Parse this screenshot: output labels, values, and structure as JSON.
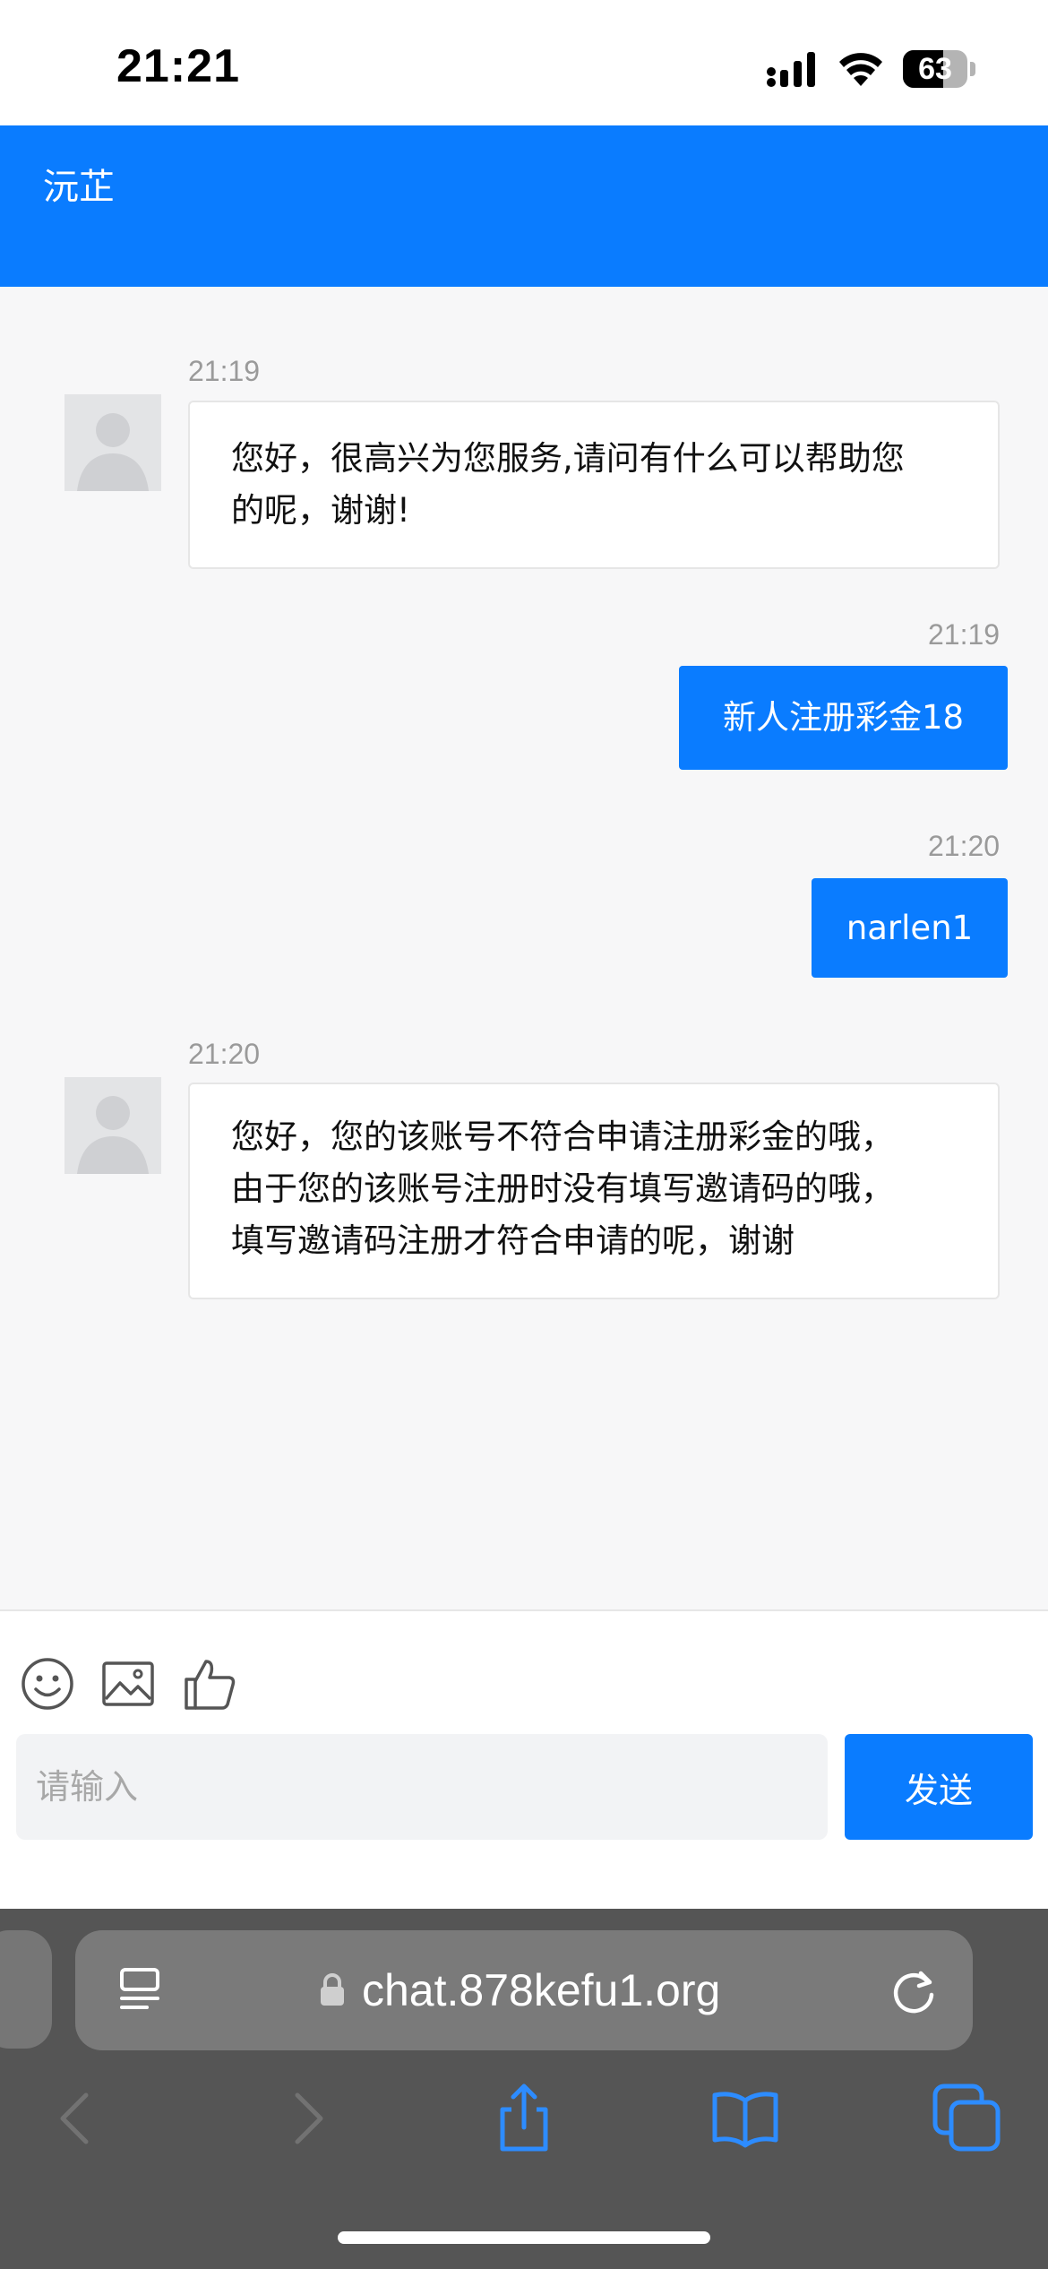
{
  "status_bar": {
    "time": "21:21",
    "battery_level": "63",
    "battery_fraction": 0.63
  },
  "header": {
    "title": "沅芷"
  },
  "messages": [
    {
      "direction": "in",
      "time": "21:19",
      "text_lines": [
        "您好，很高兴为您服务,请问有什么可以帮助您",
        "的呢，谢谢!"
      ]
    },
    {
      "direction": "out",
      "time": "21:19",
      "text": "新人注册彩金18"
    },
    {
      "direction": "out",
      "time": "21:20",
      "text": "narlen1"
    },
    {
      "direction": "in",
      "time": "21:20",
      "text_lines": [
        "您好，您的该账号不符合申请注册彩金的哦，",
        "由于您的该账号注册时没有填写邀请码的哦，",
        "填写邀请码注册才符合申请的呢，谢谢"
      ]
    }
  ],
  "toolbar": {
    "icons": [
      "emoji-icon",
      "image-icon",
      "thumbs-up-icon"
    ]
  },
  "input": {
    "placeholder": "请输入",
    "value": "",
    "send_label": "发送"
  },
  "browser": {
    "url": "chat.878kefu1.org",
    "icons": [
      "reader-icon",
      "lock-icon",
      "reload-icon",
      "back-icon",
      "forward-icon",
      "share-icon",
      "bookmarks-icon",
      "tabs-icon"
    ]
  },
  "colors": {
    "accent": "#0a7cff",
    "chat_background": "#f7f7f8",
    "timestamp": "#9a9a9a",
    "browser_bar": "#555555"
  }
}
